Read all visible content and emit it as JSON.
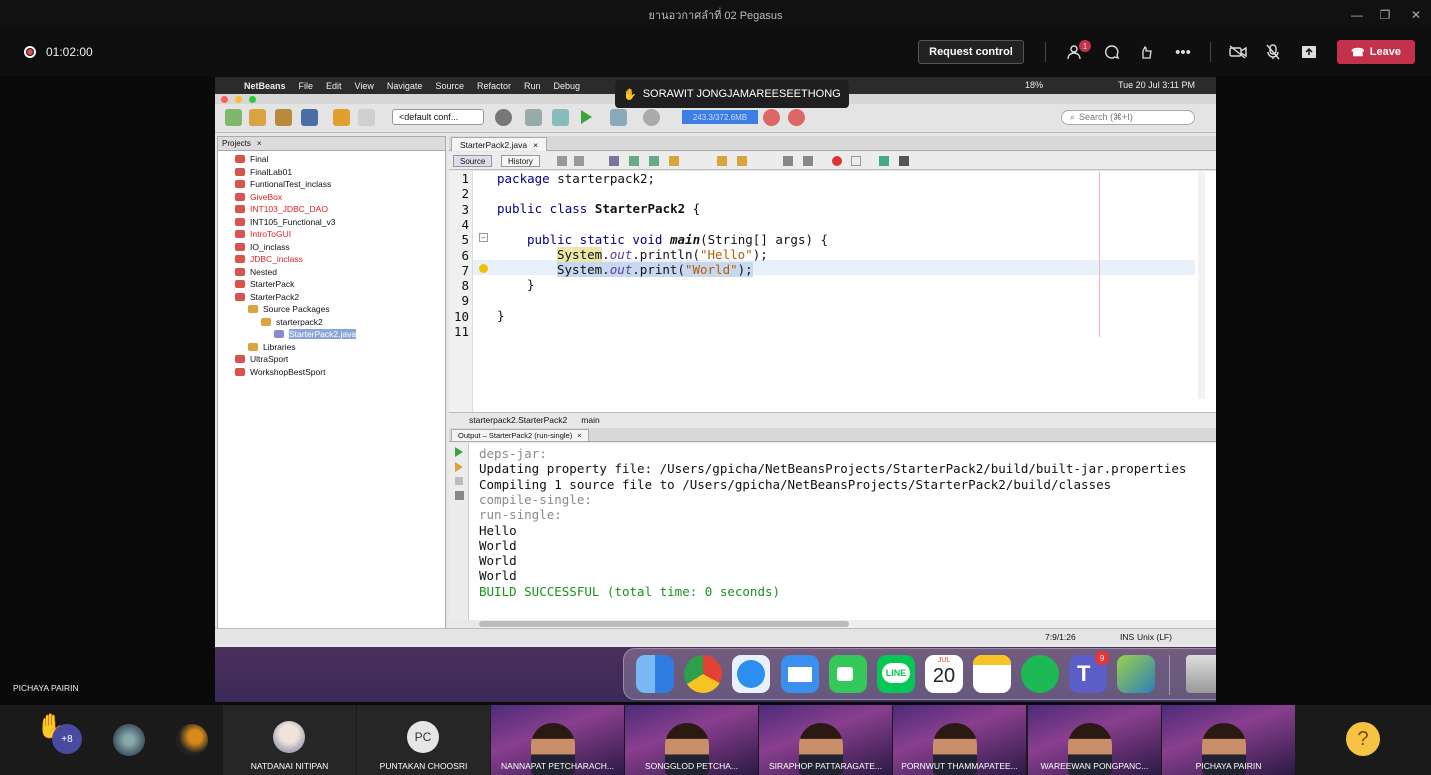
{
  "window": {
    "title": "ยานอวกาศลำที่ 02 Pegasus"
  },
  "meeting": {
    "timer": "01:02:00",
    "request_control": "Request control",
    "leave": "Leave",
    "participants_badge": "1"
  },
  "presenter_banner": "SORAWIT JONGJAMAREESEETHONG",
  "mac_menu": {
    "app": "NetBeans",
    "items": [
      "File",
      "Edit",
      "View",
      "Navigate",
      "Source",
      "Refactor",
      "Run",
      "Debug"
    ],
    "battery": "18%",
    "clock": "Tue 20 Jul  3:11 PM"
  },
  "netbeans": {
    "config": "<default conf...",
    "memory": "243.3/372.6MB",
    "search_placeholder": "Search (⌘+I)",
    "projects_tab": "Projects",
    "projects": [
      {
        "name": "Final",
        "red": false,
        "indent": 1
      },
      {
        "name": "FinalLab01",
        "red": false,
        "indent": 1
      },
      {
        "name": "FuntionalTest_inclass",
        "red": false,
        "indent": 1
      },
      {
        "name": "GiveBox",
        "red": true,
        "indent": 1
      },
      {
        "name": "INT103_JDBC_DAO",
        "red": true,
        "indent": 1
      },
      {
        "name": "INT105_Functional_v3",
        "red": false,
        "indent": 1
      },
      {
        "name": "IntroToGUI",
        "red": true,
        "indent": 1
      },
      {
        "name": "IO_inclass",
        "red": false,
        "indent": 1
      },
      {
        "name": "JDBC_inclass",
        "red": true,
        "indent": 1
      },
      {
        "name": "Nested",
        "red": false,
        "indent": 1
      },
      {
        "name": "StarterPack",
        "red": false,
        "indent": 1
      },
      {
        "name": "StarterPack2",
        "red": false,
        "indent": 1
      },
      {
        "name": "Source Packages",
        "red": false,
        "indent": 2
      },
      {
        "name": "starterpack2",
        "red": false,
        "indent": 3
      },
      {
        "name": "StarterPack2.java",
        "red": false,
        "indent": 4
      },
      {
        "name": "Libraries",
        "red": false,
        "indent": 2
      },
      {
        "name": "UltraSport",
        "red": false,
        "indent": 1
      },
      {
        "name": "WorkshopBestSport",
        "red": false,
        "indent": 1
      }
    ],
    "editor_tab": "StarterPack2.java",
    "source_btn": "Source",
    "history_btn": "History",
    "line_numbers": [
      "1",
      "2",
      "3",
      "4",
      "5",
      "6",
      "7",
      "8",
      "9",
      "10",
      "11"
    ],
    "code": {
      "l1_kw": "package",
      "l1_rest": " starterpack2;",
      "l3_kw": "public class",
      "l3_name": " StarterPack2",
      "l3_rest": " {",
      "l5_kw": "public static void",
      "l5_name": "main",
      "l5_rest": "(String[] args) {",
      "l6_sys": "System",
      "l6_dot": ".",
      "l6_out": "out",
      "l6_call": ".println(",
      "l6_str": "\"Hello\"",
      "l6_end": ");",
      "l7_sys": "System",
      "l7_dot": ".",
      "l7_out": "out",
      "l7_call": ".print(",
      "l7_str": "\"World\"",
      "l7_end": ");",
      "l8": "}",
      "l10": "}"
    },
    "breadcrumb_class": "starterpack2.StarterPack2",
    "breadcrumb_method": "main",
    "output_tab": "Output – StarterPack2 (run-single)",
    "output_lines": [
      {
        "text": "deps-jar:",
        "style": "gray"
      },
      {
        "text": "Updating property file: /Users/gpicha/NetBeansProjects/StarterPack2/build/built-jar.properties",
        "style": "normal"
      },
      {
        "text": "Compiling 1 source file to /Users/gpicha/NetBeansProjects/StarterPack2/build/classes",
        "style": "normal"
      },
      {
        "text": "compile-single:",
        "style": "gray"
      },
      {
        "text": "run-single:",
        "style": "gray"
      },
      {
        "text": "Hello",
        "style": "normal"
      },
      {
        "text": "World",
        "style": "normal"
      },
      {
        "text": "World",
        "style": "normal"
      },
      {
        "text": "World",
        "style": "normal"
      },
      {
        "text": "BUILD SUCCESSFUL (total time: 0 seconds)",
        "style": "ok"
      }
    ],
    "status_pos": "7:9/1:26",
    "status_mode": "INS",
    "status_eol": "Unix (LF)"
  },
  "dock": {
    "calendar_month": "JUL",
    "calendar_day": "20",
    "teams_badge": "9"
  },
  "presenter_name": "PICHAYA PAIRIN",
  "participants": {
    "more_count": "+8",
    "tiles": [
      {
        "name": "NATDANAI NITIPAN",
        "kind": "avatar"
      },
      {
        "name": "PUNTAKAN CHOOSRI",
        "kind": "initials",
        "initials": "PC"
      },
      {
        "name": "NANNAPAT PETCHARACH...",
        "kind": "video"
      },
      {
        "name": "SONGGLOD PETCHA...",
        "kind": "video"
      },
      {
        "name": "SIRAPHOP PATTARAGATE...",
        "kind": "video"
      },
      {
        "name": "PORNWUT THAMMAPATEE...",
        "kind": "video"
      },
      {
        "name": "WAREEWAN PONGPANC...",
        "kind": "video"
      },
      {
        "name": "PICHAYA PAIRIN",
        "kind": "video"
      }
    ]
  },
  "colors": {
    "leave": "#c4314b",
    "build_ok": "#18931c",
    "memory_bar": "#3d7ee6"
  }
}
